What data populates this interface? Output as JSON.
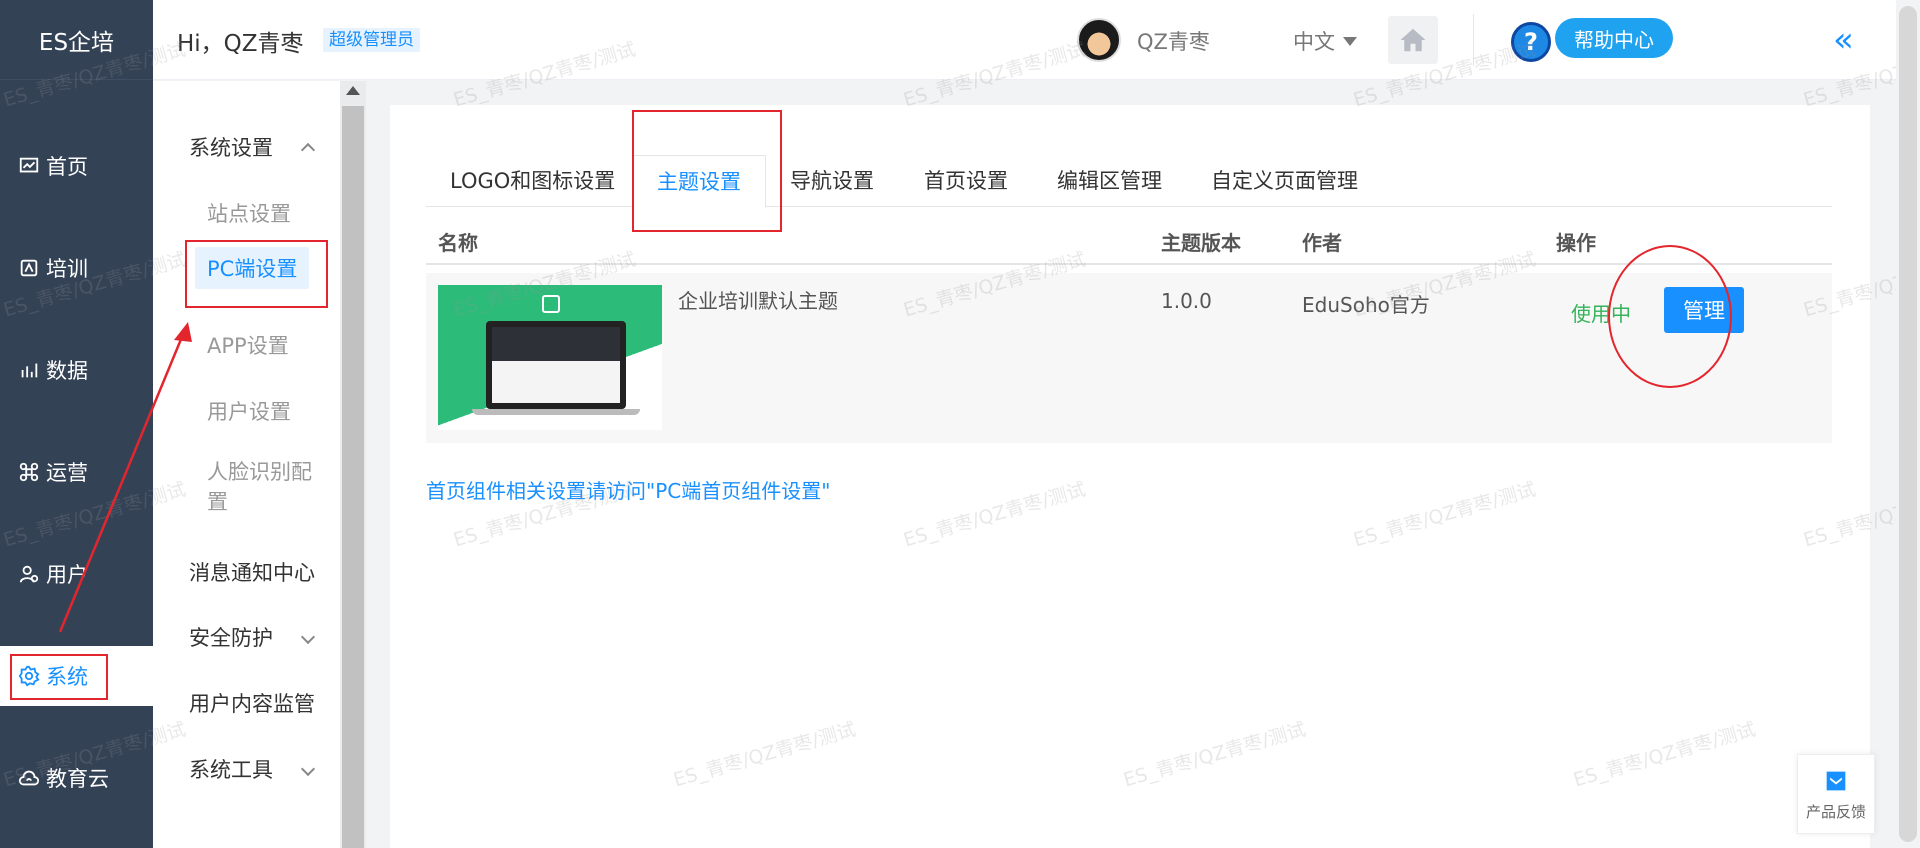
{
  "brand": "ES企培",
  "nav": {
    "items": [
      {
        "label": "首页",
        "icon": "dashboard-icon"
      },
      {
        "label": "培训",
        "icon": "training-icon"
      },
      {
        "label": "数据",
        "icon": "data-icon"
      },
      {
        "label": "运营",
        "icon": "operations-icon"
      },
      {
        "label": "用户",
        "icon": "user-icon"
      },
      {
        "label": "系统",
        "icon": "gear-icon"
      },
      {
        "label": "教育云",
        "icon": "cloud-icon"
      }
    ],
    "active": "系统"
  },
  "header": {
    "greeting": "Hi，QZ青枣",
    "role": "超级管理员",
    "username": "QZ青枣",
    "language": "中文",
    "help_icon_text": "?",
    "help_label": "帮助中心",
    "collapse_icon": "«"
  },
  "submenu": {
    "group1": "系统设置",
    "items": [
      "站点设置",
      "PC端设置",
      "APP设置",
      "用户设置",
      "人脸识别配置"
    ],
    "active": "PC端设置",
    "group2": "消息通知中心",
    "group3": "安全防护",
    "group4": "用户内容监管",
    "group5": "系统工具"
  },
  "tabs": [
    "LOGO和图标设置",
    "主题设置",
    "导航设置",
    "首页设置",
    "编辑区管理",
    "自定义页面管理"
  ],
  "active_tab": "主题设置",
  "table": {
    "headers": {
      "name": "名称",
      "version": "主题版本",
      "author": "作者",
      "action": "操作"
    },
    "rows": [
      {
        "name": "企业培训默认主题",
        "version": "1.0.0",
        "author": "EduSoho官方",
        "status": "使用中",
        "action_label": "管理"
      }
    ]
  },
  "hint": "首页组件相关设置请访问\"PC端首页组件设置\"",
  "watermark": "ES_青枣/QZ青枣/测试",
  "feedback_label": "产品反馈",
  "colors": {
    "nav_bg": "#344256",
    "accent": "#1890ff",
    "success": "#36b35a",
    "annotation": "#e3262d"
  }
}
